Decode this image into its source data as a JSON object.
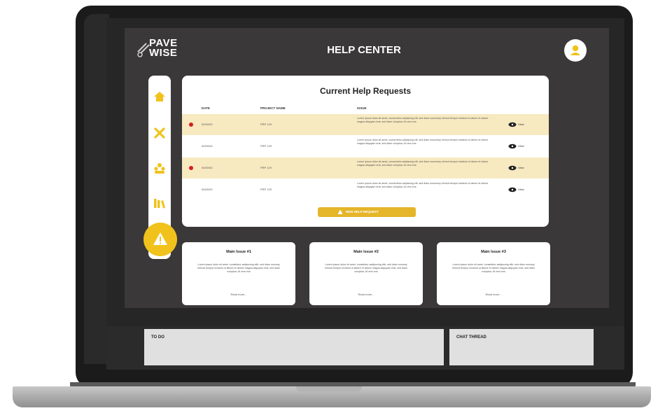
{
  "header": {
    "logo_line1": "PAVE",
    "logo_line2": "WISE",
    "title": "HELP CENTER",
    "avatar_icon": "user-icon"
  },
  "sidebar": {
    "items": [
      {
        "icon": "home-icon"
      },
      {
        "icon": "tools-icon"
      },
      {
        "icon": "team-icon"
      },
      {
        "icon": "library-icon"
      }
    ],
    "alert_icon": "warning-icon",
    "accent_color": "#f1c21b"
  },
  "requests": {
    "title": "Current Help Requests",
    "columns": [
      "DATE",
      "PROJECT NAME",
      "ISSUE"
    ],
    "rows": [
      {
        "highlight": true,
        "unread": true,
        "date": "00/00/00",
        "project": "PRP 129",
        "issue": "Lorem ipsum dolor sit amet, consectetur adipiscing elit, sed diam nonummy eirmod tempor invidunt ut labore et dolore magna aliquyam erat, sed diam voluptua. At vero eos",
        "view": "View"
      },
      {
        "highlight": false,
        "unread": false,
        "date": "00/00/00",
        "project": "PRP 129",
        "issue": "Lorem ipsum dolor sit amet, consectetur adipiscing elit, sed diam nonummy eirmod tempor invidunt ut labore et dolore magna aliquyam erat, sed diam voluptua. At vero eos",
        "view": "View"
      },
      {
        "highlight": true,
        "unread": true,
        "date": "00/00/00",
        "project": "PRP 129",
        "issue": "Lorem ipsum dolor sit amet, consectetur adipiscing elit, sed diam nonummy eirmod tempor invidunt ut labore et dolore magna aliquyam erat, sed diam voluptua. At vero eos",
        "view": "View"
      },
      {
        "highlight": false,
        "unread": false,
        "date": "00/00/00",
        "project": "PRP 129",
        "issue": "Lorem ipsum dolor sit amet, consectetur adipiscing elit, sed diam nonummy eirmod tempor invidunt ut labore et dolore magna aliquyam erat, sed diam voluptua. At vero eos",
        "view": "View"
      }
    ],
    "new_request_label": "NEW HELP REQUEST",
    "highlight_color": "#f7e9c0",
    "unread_color": "#d21f1f"
  },
  "issues": [
    {
      "title": "Main Issue #1",
      "body": "Lorem ipsum dolor sit amet, consetetur sadipscing elitr, sed diam nonumy eirmod tempor invidunt ut labore et dolore magna aliquyam erat, sed diam voluptua. At vero eos",
      "more": "Read more..."
    },
    {
      "title": "Main Issue #2",
      "body": "Lorem ipsum dolor sit amet, consetetur sadipscing elitr, sed diam nonumy eirmod tempor invidunt ut labore et dolore magna aliquyam erat, sed diam voluptua. At vero eos",
      "more": "Read more..."
    },
    {
      "title": "Main Issue #3",
      "body": "Lorem ipsum dolor sit amet, consetetur sadipscing elitr, sed diam nonumy eirmod tempor invidunt ut labore et dolore magna aliquyam erat, sed diam voluptua. At vero eos",
      "more": "Read more..."
    }
  ],
  "lower_panels": {
    "left_label": "TO DO",
    "right_label": "CHAT THREAD"
  }
}
